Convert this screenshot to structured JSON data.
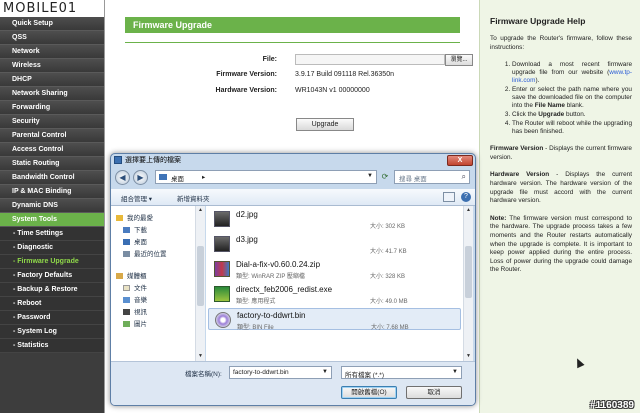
{
  "logo_text": "MOBILE01",
  "watermark": "#1160389",
  "menu": {
    "items": [
      {
        "label": "Quick Setup"
      },
      {
        "label": "QSS"
      },
      {
        "label": "Network"
      },
      {
        "label": "Wireless"
      },
      {
        "label": "DHCP"
      },
      {
        "label": "Network Sharing"
      },
      {
        "label": "Forwarding"
      },
      {
        "label": "Security"
      },
      {
        "label": "Parental Control"
      },
      {
        "label": "Access Control"
      },
      {
        "label": "Static Routing"
      },
      {
        "label": "Bandwidth Control"
      },
      {
        "label": "IP & MAC Binding"
      },
      {
        "label": "Dynamic DNS"
      },
      {
        "label": "System Tools"
      }
    ],
    "subitems": [
      {
        "label": "- Time Settings"
      },
      {
        "label": "- Diagnostic"
      },
      {
        "label": "- Firmware Upgrade"
      },
      {
        "label": "- Factory Defaults"
      },
      {
        "label": "- Backup & Restore"
      },
      {
        "label": "- Reboot"
      },
      {
        "label": "- Password"
      },
      {
        "label": "- System Log"
      },
      {
        "label": "- Statistics"
      }
    ],
    "active_item": "System Tools",
    "active_subitem": "- Firmware Upgrade",
    "accent_color": "#6bb24a"
  },
  "main": {
    "title": "Firmware Upgrade",
    "file_label": "File:",
    "browse_label": "瀏覽...",
    "firmware_version_label": "Firmware Version:",
    "firmware_version": "3.9.17 Build 091118 Rel.36350n",
    "hardware_version_label": "Hardware Version:",
    "hardware_version": "WR1043N v1 00000000",
    "upgrade_label": "Upgrade"
  },
  "dialog": {
    "title": "選擇要上傳的檔案",
    "close_label": "X",
    "address_location": "桌面",
    "address_separator": "▸",
    "search_placeholder": "搜尋 桌面",
    "toolbar": {
      "organize": "組合管理 ▾",
      "new_folder": "新增資料夾"
    },
    "nav_items": [
      {
        "label": "我的最愛",
        "icon": "star-icon"
      },
      {
        "label": "下載",
        "icon": "download-icon"
      },
      {
        "label": "桌面",
        "icon": "desktop-icon"
      },
      {
        "label": "最近的位置",
        "icon": "recent-icon"
      },
      {
        "label": "媒體櫃",
        "icon": "library-icon"
      },
      {
        "label": "文件",
        "icon": "documents-icon"
      },
      {
        "label": "音樂",
        "icon": "music-icon"
      },
      {
        "label": "視訊",
        "icon": "video-icon"
      },
      {
        "label": "圖片",
        "icon": "pictures-icon"
      }
    ],
    "files": [
      {
        "name": "d2.jpg",
        "type": "",
        "size": "大小: 302 KB",
        "icon": "image-file-icon"
      },
      {
        "name": "d3.jpg",
        "type": "",
        "size": "大小: 41.7 KB",
        "icon": "image-file-icon"
      },
      {
        "name": "Dial-a-fix-v0.60.0.24.zip",
        "type": "類型: WinRAR ZIP 壓縮檔",
        "size": "大小: 328 KB",
        "icon": "zip-file-icon"
      },
      {
        "name": "directx_feb2006_redist.exe",
        "type": "類型: 應用程式",
        "size": "大小: 49.0 MB",
        "icon": "exe-file-icon"
      },
      {
        "name": "factory-to-ddwrt.bin",
        "type": "類型: BIN File",
        "size": "大小: 7.68 MB",
        "icon": "bin-file-icon"
      }
    ],
    "selected_file": "factory-to-ddwrt.bin",
    "filename_label": "檔案名稱(N):",
    "filename_value": "factory-to-ddwrt.bin",
    "filetype_value": "所有檔案 (*.*)",
    "open_label": "開啟舊檔(O)",
    "cancel_label": "取消"
  },
  "help": {
    "title": "Firmware Upgrade Help",
    "intro": "To upgrade the Router's firmware, follow these instructions:",
    "step1_a": "Download a most recent firmware upgrade file from our website (",
    "step1_link": "www.tp-link.com",
    "step1_b": ").",
    "step2_a": "Enter or select the path name where you save the downloaded file on the computer into the ",
    "step2_bold": "File Name",
    "step2_b": " blank.",
    "step3_a": "Click the ",
    "step3_bold": "Upgrade",
    "step3_b": " button.",
    "step4": "The Router will reboot while the upgrading has been finished.",
    "fw_bold": "Firmware Version",
    "fw_text": " - Displays the current firmware version.",
    "hw_bold": "Hardware Version",
    "hw_text": " - Displays the current hardware version. The hardware version of the upgrade file must accord with the current hardware version.",
    "note_bold": "Note:",
    "note_text": " The firmware version must correspond to the hardware. The upgrade process takes a few moments and the Router restarts automatically when the upgrade is complete. It is important to keep power applied during the entire process. Loss of power during the upgrade could damage the Router."
  }
}
